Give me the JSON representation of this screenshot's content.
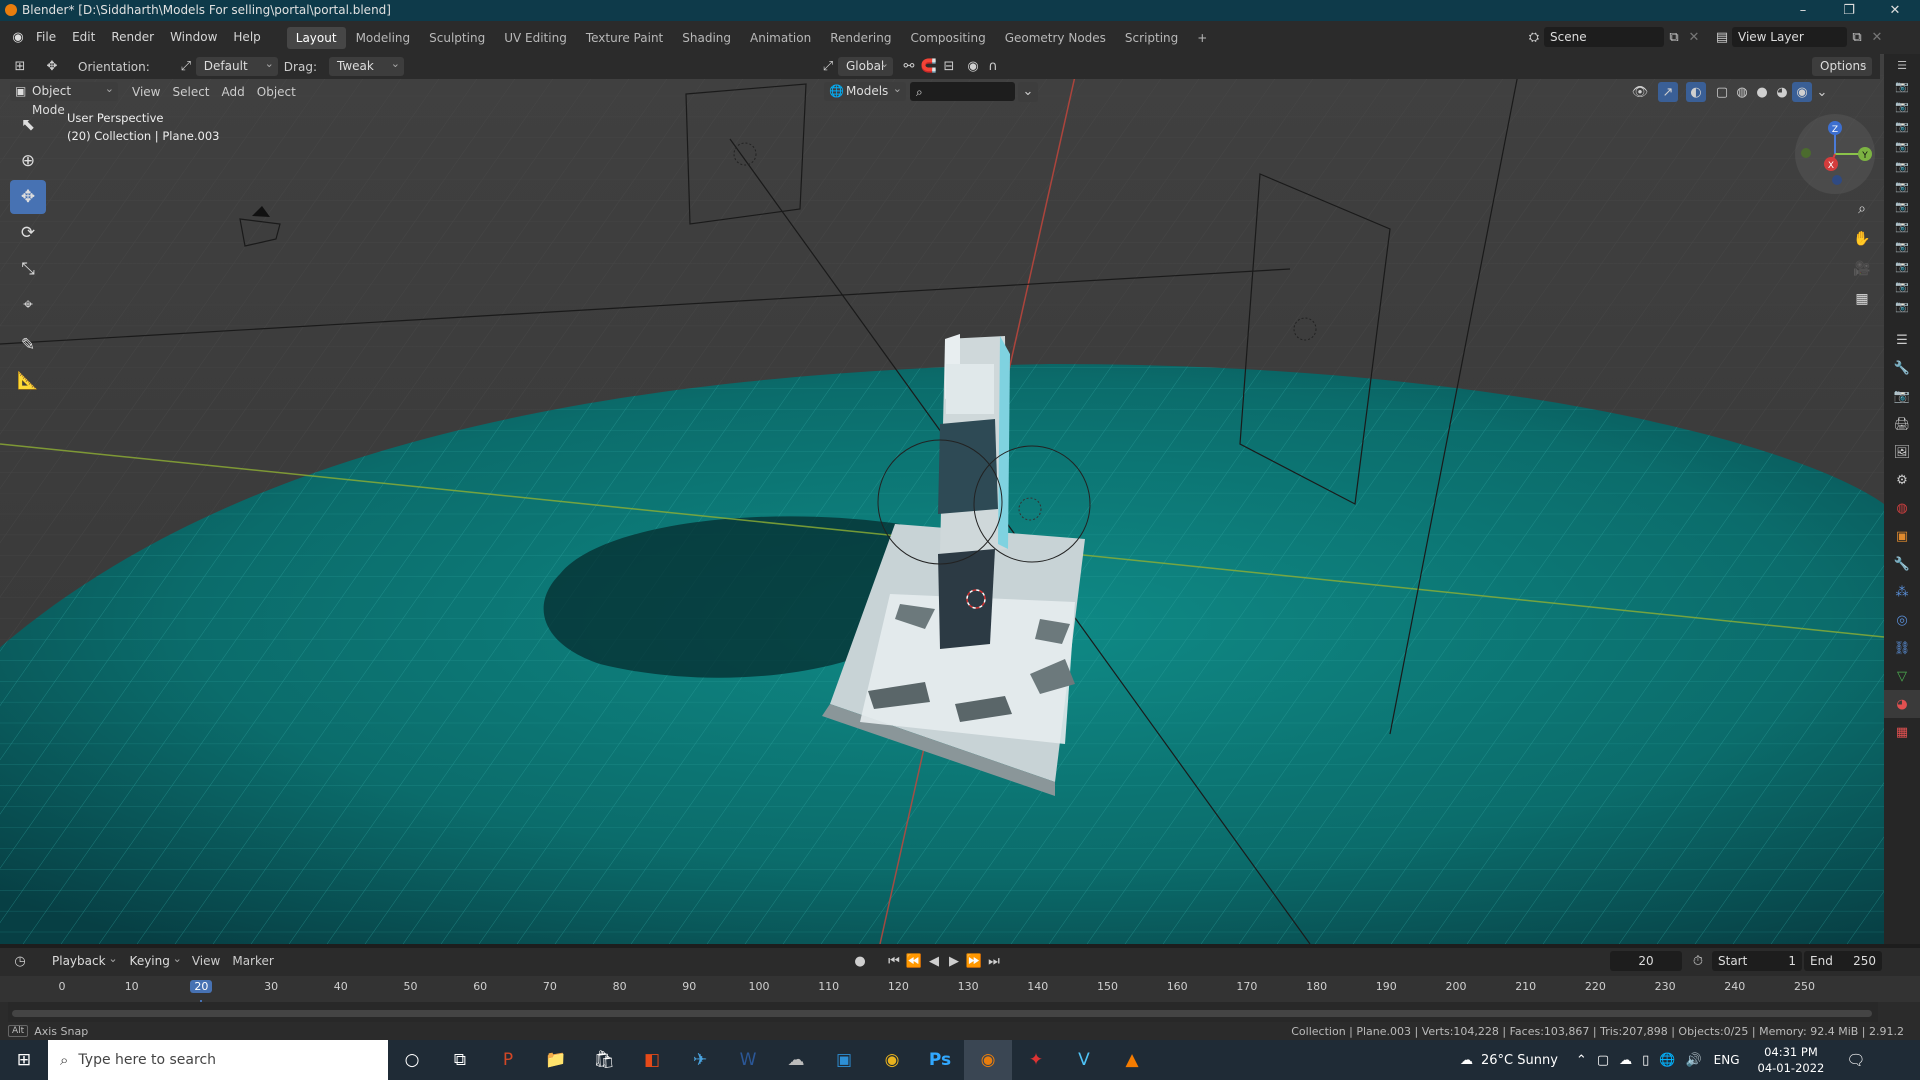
{
  "window": {
    "title": "Blender* [D:\\Siddharth\\Models For selling\\portal\\portal.blend]"
  },
  "menu": [
    "File",
    "Edit",
    "Render",
    "Window",
    "Help"
  ],
  "workspaces": [
    "Layout",
    "Modeling",
    "Sculpting",
    "UV Editing",
    "Texture Paint",
    "Shading",
    "Animation",
    "Rendering",
    "Compositing",
    "Geometry Nodes",
    "Scripting"
  ],
  "active_workspace": "Layout",
  "scene": {
    "name": "Scene",
    "view_layer": "View Layer"
  },
  "tool_header": {
    "orientation_label": "Orientation:",
    "orientation_value": "Default",
    "drag_label": "Drag:",
    "drag_value": "Tweak",
    "transform_orientation": "Global",
    "options_label": "Options"
  },
  "viewport_header": {
    "mode": "Object Mode",
    "menus": [
      "View",
      "Select",
      "Add",
      "Object"
    ],
    "collection_filter": "Models"
  },
  "viewport": {
    "perspective_label": "User Perspective",
    "collection_label": "(20) Collection | Plane.003"
  },
  "gizmo": {
    "x": "X",
    "y": "Y",
    "z": "Z"
  },
  "timeline": {
    "menus": [
      "Playback",
      "Keying",
      "View",
      "Marker"
    ],
    "current_frame": "20",
    "start_label": "Start",
    "start_value": "1",
    "end_label": "End",
    "end_value": "250",
    "ticks": [
      "0",
      "10",
      "20",
      "30",
      "40",
      "50",
      "60",
      "70",
      "80",
      "90",
      "100",
      "110",
      "120",
      "130",
      "140",
      "150",
      "160",
      "170",
      "180",
      "190",
      "200",
      "210",
      "220",
      "230",
      "240",
      "250"
    ]
  },
  "statusbar": {
    "left": "Axis Snap",
    "alt_key": "Alt",
    "right": "Collection | Plane.003 | Verts:104,228 | Faces:103,867 | Tris:207,898 | Objects:0/25 | Memory: 92.4 MiB | 2.91.2"
  },
  "taskbar": {
    "search_placeholder": "Type here to search",
    "weather": "26°C  Sunny",
    "language": "ENG",
    "time": "04:31 PM",
    "date": "04-01-2022"
  }
}
